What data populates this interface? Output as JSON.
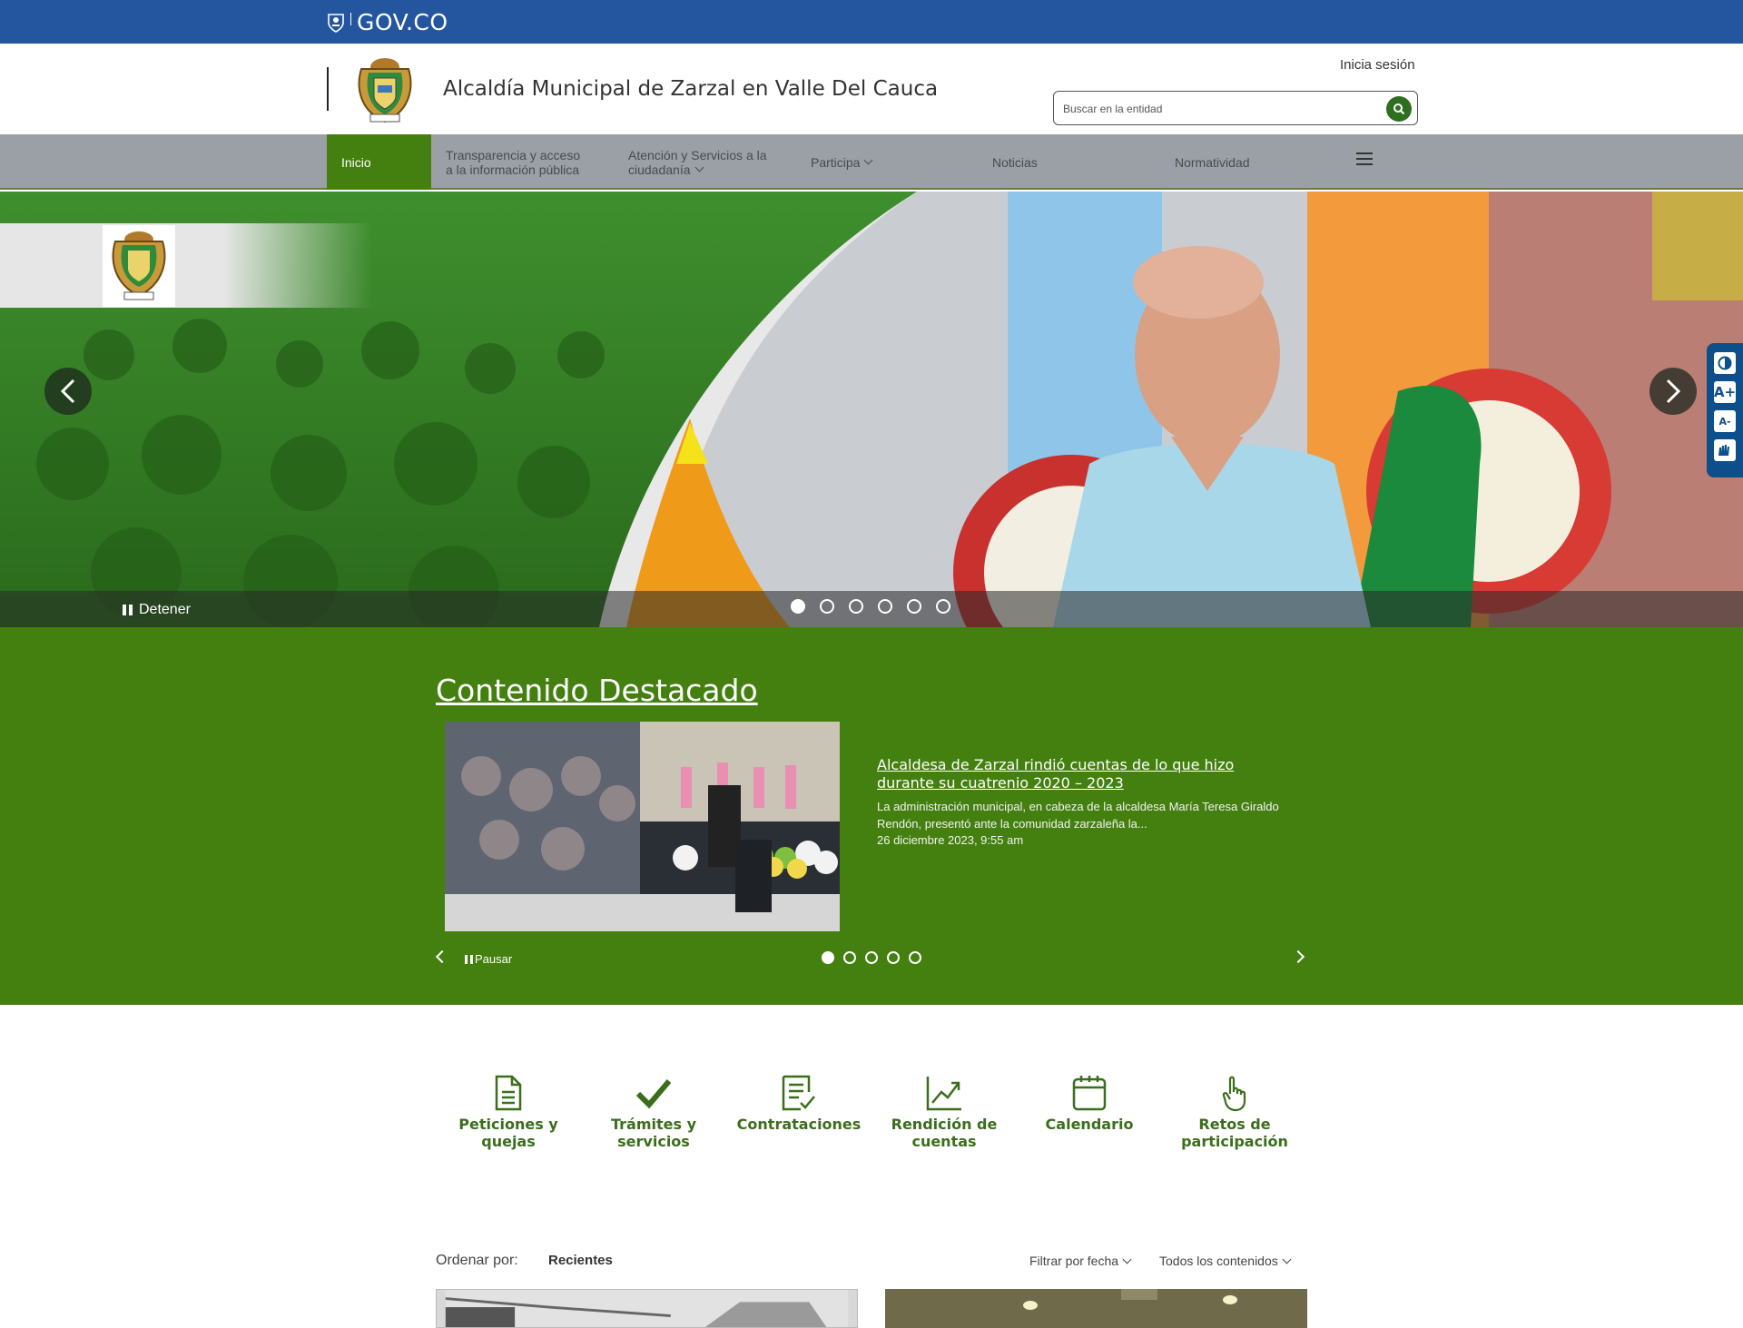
{
  "gov_bar": {
    "logo_text": "GOV.CO"
  },
  "header": {
    "entity_name": "Alcaldía Municipal de Zarzal en Valle Del Cauca",
    "login_label": "Inicia sesión",
    "search_placeholder": "Buscar en la entidad"
  },
  "nav": {
    "items": [
      {
        "label": "Inicio"
      },
      {
        "label_line1": "Transparencia y acceso",
        "label_line2": "a la información pública"
      },
      {
        "label_line1": "Atención y Servicios a la",
        "label_line2": "ciudadanía"
      },
      {
        "label": "Participa"
      },
      {
        "label": "Noticias"
      },
      {
        "label": "Normatividad"
      }
    ],
    "menu_icon": "hamburger-icon"
  },
  "hero": {
    "stop_label": "Detener",
    "slide_count": 6,
    "active_slide": 1
  },
  "accessibility": {
    "buttons": [
      {
        "icon": "contrast-icon"
      },
      {
        "label": "A+"
      },
      {
        "label": "A-"
      },
      {
        "icon": "sign-language-icon"
      }
    ]
  },
  "featured": {
    "title": "Contenido Destacado",
    "news_title": "Alcaldesa de Zarzal rindió cuentas de lo que hizo durante su cuatrenio 2020 – 2023",
    "news_summary": " La administración municipal, en cabeza de la alcaldesa María Teresa Giraldo Rendón, presentó ante la comunidad zarzaleña la...",
    "news_date": "26 diciembre 2023, 9:55 am",
    "pause_label": "Pausar",
    "slide_count": 5,
    "active_slide": 1
  },
  "quick_links": [
    {
      "label": "Peticiones y quejas",
      "icon": "document-icon"
    },
    {
      "label": "Trámites y servicios",
      "icon": "checkmark-icon"
    },
    {
      "label": "Contrataciones",
      "icon": "contract-icon"
    },
    {
      "label": "Rendición de cuentas",
      "icon": "chart-icon"
    },
    {
      "label": "Calendario",
      "icon": "calendar-icon"
    },
    {
      "label": "Retos de participación",
      "icon": "hand-icon"
    }
  ],
  "filters": {
    "order_label": "Ordenar por:",
    "order_value": "Recientes",
    "date_filter": "Filtrar por fecha",
    "content_filter": "Todos los contenidos"
  },
  "colors": {
    "gov_blue": "#23569f",
    "primary_green": "#44800f",
    "nav_gray": "#9aa0a6",
    "a11y_blue": "#0d4f8a"
  }
}
